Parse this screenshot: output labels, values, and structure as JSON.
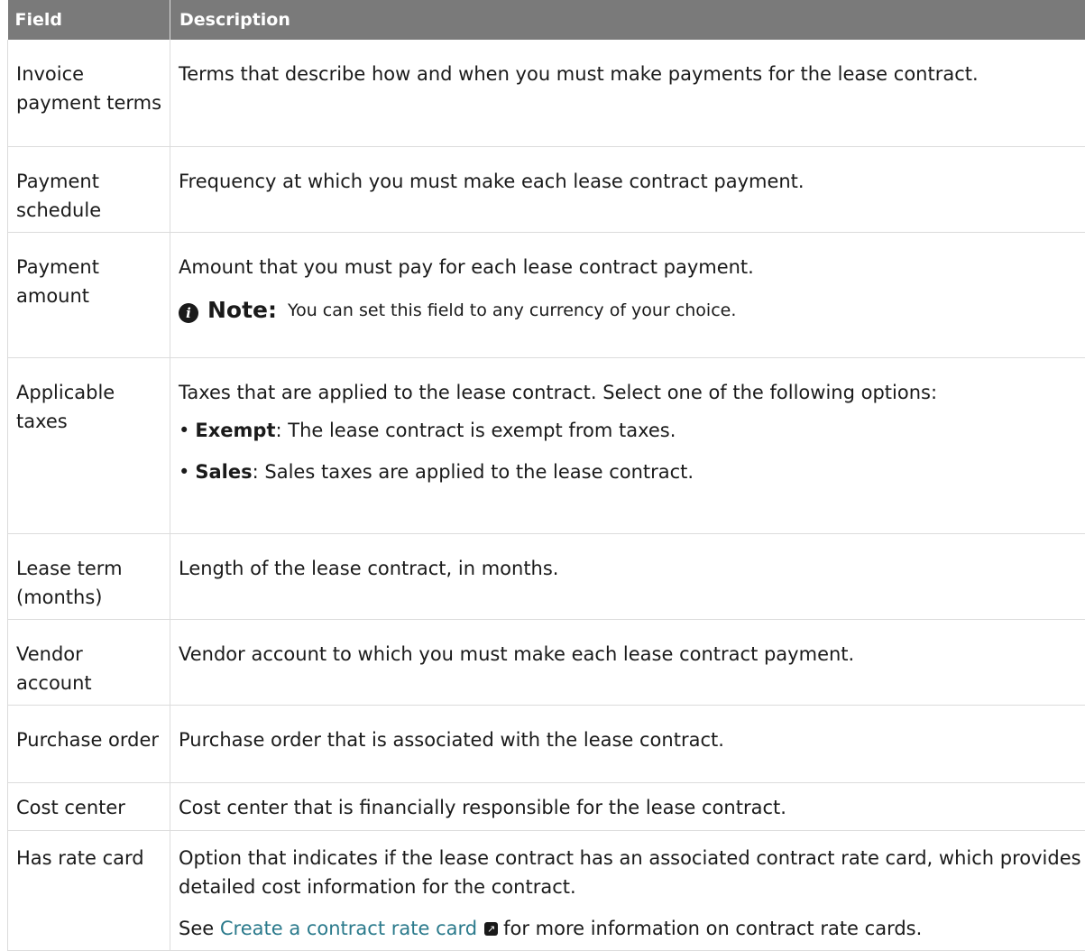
{
  "table": {
    "headers": {
      "field": "Field",
      "description": "Description"
    },
    "rows": [
      {
        "field": "Invoice payment terms",
        "description": "Terms that describe how and when you must make payments for the lease contract."
      },
      {
        "field": "Payment schedule",
        "description": "Frequency at which you must make each lease contract payment."
      },
      {
        "field": "Payment amount",
        "description": "Amount that you must pay for each lease contract payment.",
        "note": {
          "label": "Note:",
          "text": "You can set this field to any currency of your choice."
        }
      },
      {
        "field": "Applicable taxes",
        "description": "Taxes that are applied to the lease contract. Select one of the following options:",
        "options": [
          {
            "name": "Exempt",
            "text": ": The lease contract is exempt from taxes."
          },
          {
            "name": "Sales",
            "text": ": Sales taxes are applied to the lease contract."
          }
        ]
      },
      {
        "field": "Lease term (months)",
        "description": "Length of the lease contract, in months."
      },
      {
        "field": "Vendor account",
        "description": "Vendor account to which you must make each lease contract payment."
      },
      {
        "field": "Purchase order",
        "description": "Purchase order that is associated with the lease contract."
      },
      {
        "field": "Cost center",
        "description": "Cost center that is financially responsible for the lease contract."
      },
      {
        "field": "Has rate card",
        "description": "Option that indicates if the lease contract has an associated contract rate card, which provides detailed cost information for the contract.",
        "see": {
          "prefix": "See",
          "link_text": "Create a contract rate card",
          "suffix": "for more information on contract rate cards."
        }
      }
    ]
  },
  "icons": {
    "note": "info-icon",
    "external_link": "external-link-icon"
  },
  "colors": {
    "header_bg": "#7a7a7a",
    "header_text": "#ffffff",
    "link": "#2b7a8c",
    "border": "#dcdcdc"
  }
}
